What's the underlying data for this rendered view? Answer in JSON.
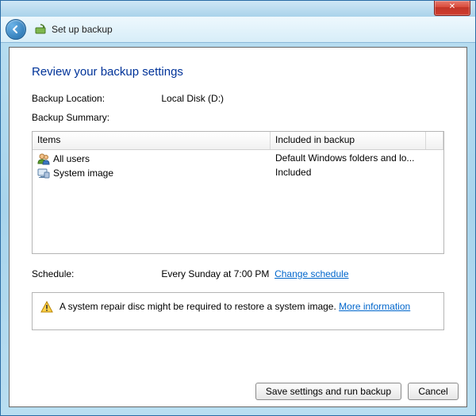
{
  "navbar": {
    "title": "Set up backup"
  },
  "page": {
    "heading": "Review your backup settings",
    "location_label": "Backup Location:",
    "location_value": "Local Disk (D:)",
    "summary_label": "Backup Summary:"
  },
  "table": {
    "col_items": "Items",
    "col_included": "Included in backup",
    "rows": [
      {
        "name": "All users",
        "included": "Default Windows folders and lo..."
      },
      {
        "name": "System image",
        "included": "Included"
      }
    ]
  },
  "schedule": {
    "label": "Schedule:",
    "value": "Every Sunday at 7:00 PM",
    "change_link": "Change schedule"
  },
  "warning": {
    "text": "A system repair disc might be required to restore a system image.",
    "more_link": "More information"
  },
  "footer": {
    "save": "Save settings and run backup",
    "cancel": "Cancel"
  },
  "close_glyph": "✕"
}
